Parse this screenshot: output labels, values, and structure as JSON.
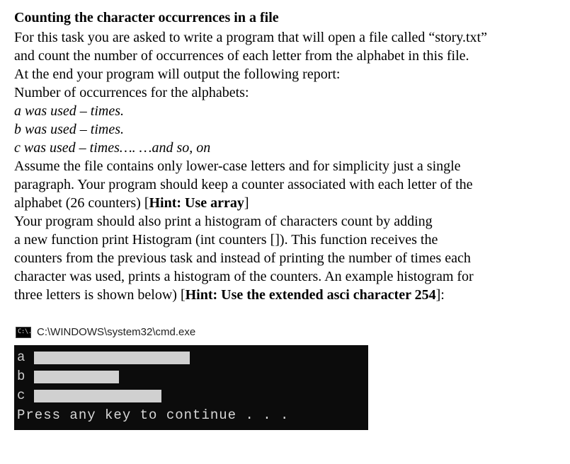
{
  "title": "Counting the character occurrences in a file",
  "line1": "For this task you are asked to write a program that will open a file called “story.txt”",
  "line2": "and count the number of occurrences of each letter from the alphabet in this file.",
  "line3": "At the end your program will output the following report:",
  "line4": "Number of occurrences for the alphabets:",
  "line5": "a was used – times.",
  "line6": "b was used – times.",
  "line7": "c was used – times…. …and so, on",
  "line8a": "Assume the file contains only lower-case letters and for simplicity just a single",
  "line8b": "paragraph. Your program should keep a counter associated with each letter of the",
  "line8c_pre": "alphabet (26 counters) [",
  "line8c_bold": "Hint: Use array",
  "line8c_post": "]",
  "line9a": "Your program should also print a histogram of characters count by adding",
  "line9b": " a new function print Histogram (int counters []). This function receives the",
  "line9c": "counters from the previous task and instead of printing the number of times each",
  "line9d": "character was used, prints a histogram of the counters. An example histogram for",
  "line9e_pre": "three letters is shown below) [",
  "line9e_bold": "Hint: Use the extended asci character 254",
  "line9e_post": "]:",
  "console": {
    "icon_text": "C:\\.",
    "title_path": "C:\\WINDOWS\\system32\\cmd.exe",
    "rows": {
      "a": "a",
      "b": "b",
      "c": "c"
    },
    "press_text": "Press any key to continue . . ."
  }
}
